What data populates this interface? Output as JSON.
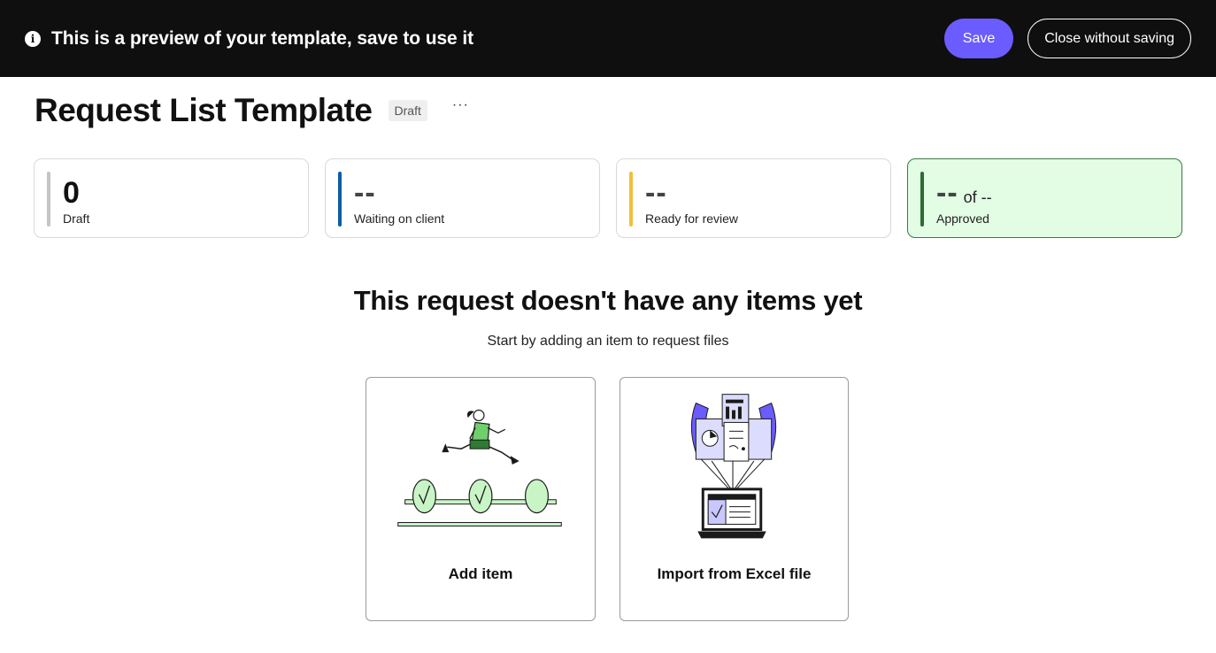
{
  "banner": {
    "message": "This is a preview of your template, save to use it",
    "info_icon": "info-icon",
    "save_label": "Save",
    "close_label": "Close without saving"
  },
  "header": {
    "title": "Request List Template",
    "status_badge": "Draft",
    "more_label": "···"
  },
  "stats": [
    {
      "value": "0",
      "label": "Draft",
      "color": "#c4c4c4"
    },
    {
      "value": "--",
      "label": "Waiting on client",
      "color": "#0b5ea8"
    },
    {
      "value": "--",
      "label": "Ready for review",
      "color": "#f2be3a"
    },
    {
      "value": "--",
      "suffix": "of --",
      "label": "Approved",
      "color": "#2f6b37"
    }
  ],
  "empty_state": {
    "title": "This request doesn't have any items yet",
    "subtitle": "Start by adding an item to request files"
  },
  "actions": {
    "add_item_label": "Add item",
    "import_label": "Import from Excel file"
  },
  "colors": {
    "banner_bg": "#0f0f0f",
    "accent": "#6b5cff",
    "approved_bg": "#e2fde4",
    "illustration_green": "#c8f4c6",
    "illustration_purple": "#6b5cff"
  }
}
